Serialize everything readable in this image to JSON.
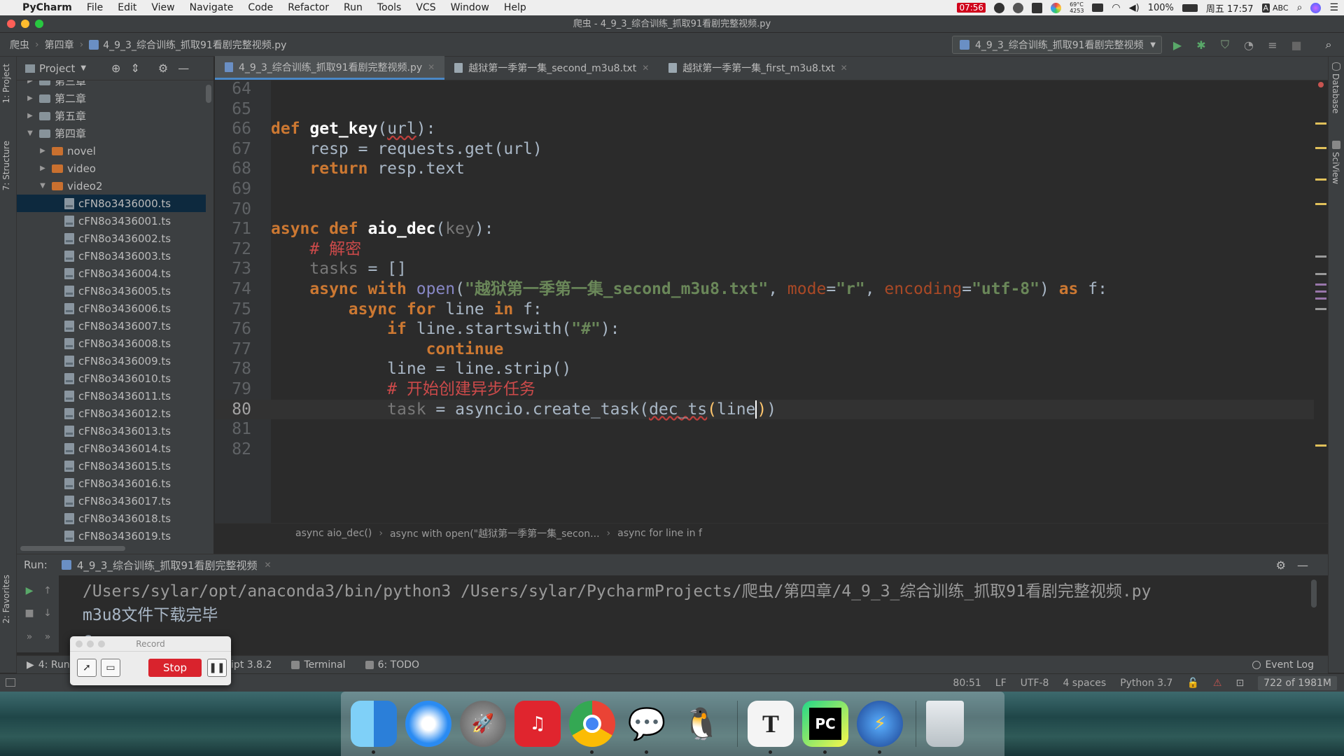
{
  "menubar": {
    "app_name": "PyCharm",
    "items": [
      "File",
      "Edit",
      "View",
      "Navigate",
      "Code",
      "Refactor",
      "Run",
      "Tools",
      "VCS",
      "Window",
      "Help"
    ],
    "status": {
      "recording_time": "07:56",
      "temperature": "69°C",
      "fan_rpm": "4253",
      "battery": "100%",
      "datetime": "周五 17:57",
      "input_method": "ABC"
    }
  },
  "window": {
    "title": "爬虫 - 4_9_3_综合训练_抓取91看剧完整视频.py"
  },
  "navbar": {
    "crumbs": [
      "爬虫",
      "第四章",
      "4_9_3_综合训练_抓取91看剧完整视频.py"
    ],
    "run_config": "4_9_3_综合训练_抓取91看剧完整视频"
  },
  "left_strip": {
    "project_tab": "1: Project",
    "structure_tab": "7: Structure",
    "favorites_tab": "2: Favorites"
  },
  "right_strip": {
    "database_tab": "Database",
    "sciview_tab": "SciView"
  },
  "project_panel": {
    "title": "Project",
    "tree": [
      {
        "label": "第三章",
        "type": "folder",
        "depth": 1,
        "expanded": false
      },
      {
        "label": "第二章",
        "type": "folder",
        "depth": 1,
        "expanded": false
      },
      {
        "label": "第五章",
        "type": "folder",
        "depth": 1,
        "expanded": false
      },
      {
        "label": "第四章",
        "type": "folder",
        "depth": 1,
        "expanded": true
      },
      {
        "label": "novel",
        "type": "folder-orange",
        "depth": 2,
        "expanded": false
      },
      {
        "label": "video",
        "type": "folder-orange",
        "depth": 2,
        "expanded": false
      },
      {
        "label": "video2",
        "type": "folder-orange",
        "depth": 2,
        "expanded": true
      },
      {
        "label": "cFN8o3436000.ts",
        "type": "file",
        "depth": 3,
        "selected": true
      },
      {
        "label": "cFN8o3436001.ts",
        "type": "file",
        "depth": 3
      },
      {
        "label": "cFN8o3436002.ts",
        "type": "file",
        "depth": 3
      },
      {
        "label": "cFN8o3436003.ts",
        "type": "file",
        "depth": 3
      },
      {
        "label": "cFN8o3436004.ts",
        "type": "file",
        "depth": 3
      },
      {
        "label": "cFN8o3436005.ts",
        "type": "file",
        "depth": 3
      },
      {
        "label": "cFN8o3436006.ts",
        "type": "file",
        "depth": 3
      },
      {
        "label": "cFN8o3436007.ts",
        "type": "file",
        "depth": 3
      },
      {
        "label": "cFN8o3436008.ts",
        "type": "file",
        "depth": 3
      },
      {
        "label": "cFN8o3436009.ts",
        "type": "file",
        "depth": 3
      },
      {
        "label": "cFN8o3436010.ts",
        "type": "file",
        "depth": 3
      },
      {
        "label": "cFN8o3436011.ts",
        "type": "file",
        "depth": 3
      },
      {
        "label": "cFN8o3436012.ts",
        "type": "file",
        "depth": 3
      },
      {
        "label": "cFN8o3436013.ts",
        "type": "file",
        "depth": 3
      },
      {
        "label": "cFN8o3436014.ts",
        "type": "file",
        "depth": 3
      },
      {
        "label": "cFN8o3436015.ts",
        "type": "file",
        "depth": 3
      },
      {
        "label": "cFN8o3436016.ts",
        "type": "file",
        "depth": 3
      },
      {
        "label": "cFN8o3436017.ts",
        "type": "file",
        "depth": 3
      },
      {
        "label": "cFN8o3436018.ts",
        "type": "file",
        "depth": 3
      },
      {
        "label": "cFN8o3436019.ts",
        "type": "file",
        "depth": 3
      }
    ]
  },
  "editor": {
    "tabs": [
      {
        "label": "4_9_3_综合训练_抓取91看剧完整视频.py",
        "active": true
      },
      {
        "label": "越狱第一季第一集_second_m3u8.txt",
        "active": false
      },
      {
        "label": "越狱第一季第一集_first_m3u8.txt",
        "active": false
      }
    ],
    "current_line": 80,
    "lines": [
      {
        "no": "64",
        "tokens": []
      },
      {
        "no": "65",
        "tokens": []
      },
      {
        "no": "66",
        "tokens": [
          {
            "t": "def ",
            "c": "kw"
          },
          {
            "t": "get_key",
            "c": "def-fn"
          },
          {
            "t": "(",
            "c": "normal"
          },
          {
            "t": "url",
            "c": "normal squiggle"
          },
          {
            "t": "):",
            "c": "normal"
          }
        ]
      },
      {
        "no": "67",
        "tokens": [
          {
            "t": "    resp ",
            "c": "normal"
          },
          {
            "t": "= ",
            "c": "normal"
          },
          {
            "t": "requests.get(url)",
            "c": "normal"
          }
        ]
      },
      {
        "no": "68",
        "tokens": [
          {
            "t": "    ",
            "c": "normal"
          },
          {
            "t": "return ",
            "c": "kw"
          },
          {
            "t": "resp.text",
            "c": "normal"
          }
        ]
      },
      {
        "no": "69",
        "tokens": []
      },
      {
        "no": "70",
        "tokens": []
      },
      {
        "no": "71",
        "tokens": [
          {
            "t": "async def ",
            "c": "kw"
          },
          {
            "t": "aio_dec",
            "c": "def-fn"
          },
          {
            "t": "(",
            "c": "normal"
          },
          {
            "t": "key",
            "c": "dim"
          },
          {
            "t": "):",
            "c": "normal"
          }
        ]
      },
      {
        "no": "72",
        "tokens": [
          {
            "t": "    ",
            "c": "normal"
          },
          {
            "t": "# 解密",
            "c": "cm"
          }
        ]
      },
      {
        "no": "73",
        "tokens": [
          {
            "t": "    ",
            "c": "normal"
          },
          {
            "t": "tasks",
            "c": "dim"
          },
          {
            "t": " = []",
            "c": "normal"
          }
        ]
      },
      {
        "no": "74",
        "tokens": [
          {
            "t": "    ",
            "c": "normal"
          },
          {
            "t": "async with ",
            "c": "kw"
          },
          {
            "t": "open",
            "c": "bi"
          },
          {
            "t": "(",
            "c": "normal"
          },
          {
            "t": "\"越狱第一季第一集_second_m3u8.txt\"",
            "c": "str"
          },
          {
            "t": ", ",
            "c": "normal"
          },
          {
            "t": "mode",
            "c": "param"
          },
          {
            "t": "=",
            "c": "normal"
          },
          {
            "t": "\"r\"",
            "c": "str"
          },
          {
            "t": ", ",
            "c": "normal"
          },
          {
            "t": "encoding",
            "c": "param"
          },
          {
            "t": "=",
            "c": "normal"
          },
          {
            "t": "\"utf-8\"",
            "c": "str"
          },
          {
            "t": ") ",
            "c": "normal"
          },
          {
            "t": "as ",
            "c": "kw"
          },
          {
            "t": "f:",
            "c": "normal"
          }
        ]
      },
      {
        "no": "75",
        "tokens": [
          {
            "t": "        ",
            "c": "normal"
          },
          {
            "t": "async for ",
            "c": "kw"
          },
          {
            "t": "line ",
            "c": "normal"
          },
          {
            "t": "in ",
            "c": "kw"
          },
          {
            "t": "f:",
            "c": "normal"
          }
        ]
      },
      {
        "no": "76",
        "tokens": [
          {
            "t": "            ",
            "c": "normal"
          },
          {
            "t": "if ",
            "c": "kw"
          },
          {
            "t": "line.startswith(",
            "c": "normal"
          },
          {
            "t": "\"#\"",
            "c": "str"
          },
          {
            "t": "):",
            "c": "normal"
          }
        ]
      },
      {
        "no": "77",
        "tokens": [
          {
            "t": "                ",
            "c": "normal"
          },
          {
            "t": "continue",
            "c": "kw"
          }
        ]
      },
      {
        "no": "78",
        "tokens": [
          {
            "t": "            line = line.strip()",
            "c": "normal"
          }
        ]
      },
      {
        "no": "79",
        "tokens": [
          {
            "t": "            ",
            "c": "normal"
          },
          {
            "t": "# 开始创建异步任务",
            "c": "cm"
          }
        ]
      },
      {
        "no": "80",
        "tokens": [
          {
            "t": "            ",
            "c": "normal"
          },
          {
            "t": "task",
            "c": "dim"
          },
          {
            "t": " = asyncio.create_task(",
            "c": "normal"
          },
          {
            "t": "dec_ts",
            "c": "normal squiggle"
          },
          {
            "t": "(",
            "c": "fn"
          },
          {
            "t": "line",
            "c": "normal"
          },
          {
            "t": ")",
            "c": "fn caret"
          },
          {
            "t": ")",
            "c": "normal"
          }
        ]
      },
      {
        "no": "81",
        "tokens": []
      },
      {
        "no": "82",
        "tokens": []
      }
    ],
    "breadcrumb": [
      "async aio_dec()",
      "async with open(\"越狱第一季第一集_secon...",
      "async for line in f"
    ]
  },
  "run_panel": {
    "label": "Run:",
    "tab": "4_9_3_综合训练_抓取91看剧完整视频",
    "console": [
      {
        "text": "/Users/sylar/opt/anaconda3/bin/python3 /Users/sylar/PycharmProjects/爬虫/第四章/4_9_3_综合训练_抓取91看剧完整视频.py",
        "kind": "cmd"
      },
      {
        "text": "m3u8文件下载完毕",
        "kind": "out"
      },
      {
        "text": "c",
        "kind": "out"
      }
    ]
  },
  "bottom_tabs": [
    {
      "label": "4: Run"
    },
    {
      "label": "Script 3.8.2"
    },
    {
      "label": "Terminal"
    },
    {
      "label": "6: TODO"
    }
  ],
  "event_log": "Event Log",
  "statusbar": {
    "position": "80:51",
    "line_sep": "LF",
    "encoding": "UTF-8",
    "indent": "4 spaces",
    "interpreter": "Python 3.7",
    "memory": "722 of 1981M"
  },
  "record_window": {
    "title": "Record",
    "stop_label": "Stop"
  },
  "dock": {
    "apps": [
      "finder-icon",
      "safari-icon",
      "launchpad-icon",
      "netease-music-icon",
      "chrome-icon",
      "wechat-icon",
      "qq-icon",
      "typora-icon",
      "pycharm-icon",
      "thunder-icon",
      "trash-icon"
    ]
  },
  "colors": {
    "editor_bg": "#2b2b2b",
    "panel_bg": "#3c3f41",
    "keyword": "#cc7832",
    "string": "#6a8759",
    "comment": "#cc4a4a",
    "stop_red": "#d9232d"
  }
}
